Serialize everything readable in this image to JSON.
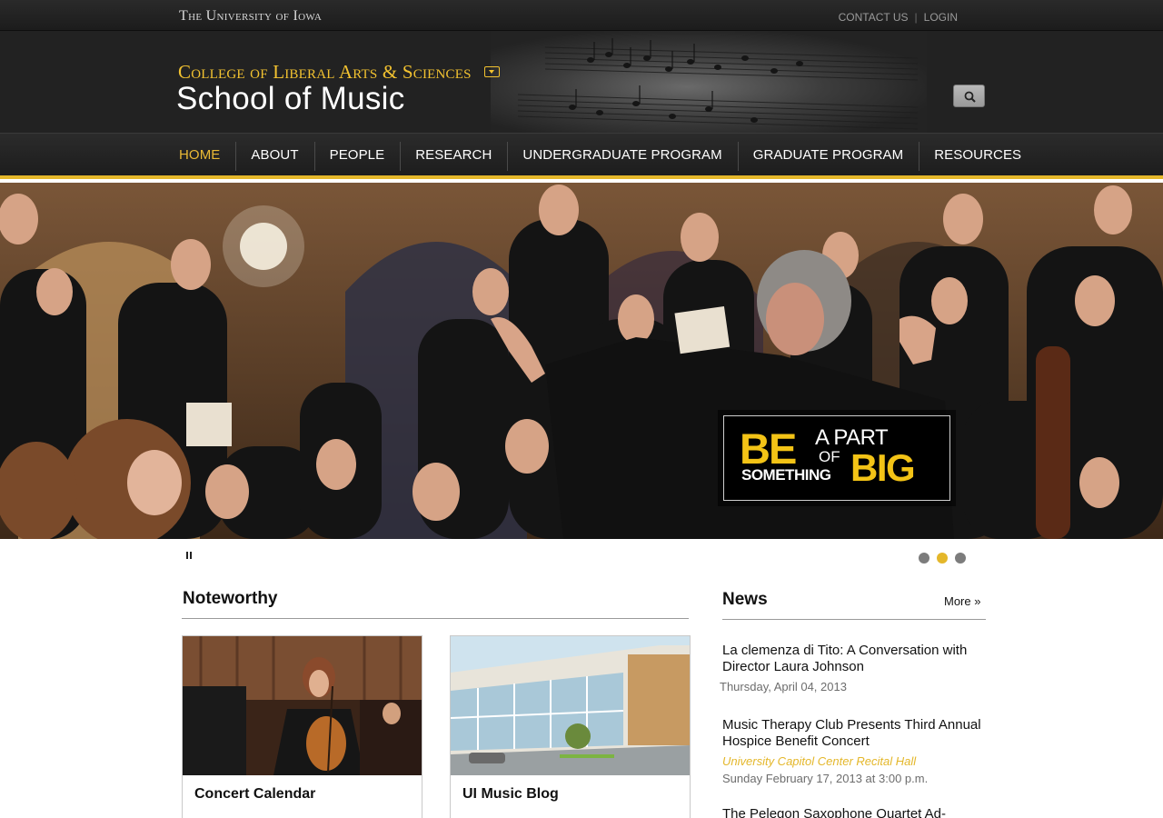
{
  "topbar": {
    "university": "The University of Iowa",
    "links": [
      "CONTACT US",
      "LOGIN"
    ],
    "separator": "|"
  },
  "header": {
    "college": "College of Liberal Arts & Sciences",
    "school": "School of Music",
    "search_icon": "search-icon",
    "dropdown_icon": "chevron-down-icon"
  },
  "nav": {
    "items": [
      "HOME",
      "ABOUT",
      "PEOPLE",
      "RESEARCH",
      "UNDERGRADUATE PROGRAM",
      "GRADUATE PROGRAM",
      "RESOURCES"
    ],
    "active_index": 0
  },
  "hero": {
    "promo": {
      "be": "BE",
      "a_part": "A PART",
      "of": "OF",
      "something": "SOMETHING",
      "big": "BIG"
    },
    "slides": 3,
    "active_slide": 2
  },
  "noteworthy": {
    "title": "Noteworthy",
    "cards": [
      {
        "label": "Concert Calendar"
      },
      {
        "label": "UI Music Blog"
      }
    ]
  },
  "news": {
    "title": "News",
    "more": "More »",
    "items": [
      {
        "headline": "La clemenza di Tito: A Conversation with Director Laura Johnson",
        "date": "Thursday, April 04, 2013"
      },
      {
        "headline": "Music Therapy Club Presents Third Annual Hospice Benefit Concert",
        "venue": "University Capitol Center Recital Hall",
        "date": "Sunday February 17, 2013 at 3:00 p.m."
      },
      {
        "headline": "The Pelegon Saxophone Quartet Ad-"
      }
    ]
  },
  "colors": {
    "gold": "#e4b72a",
    "dark": "#1f1f1f"
  }
}
